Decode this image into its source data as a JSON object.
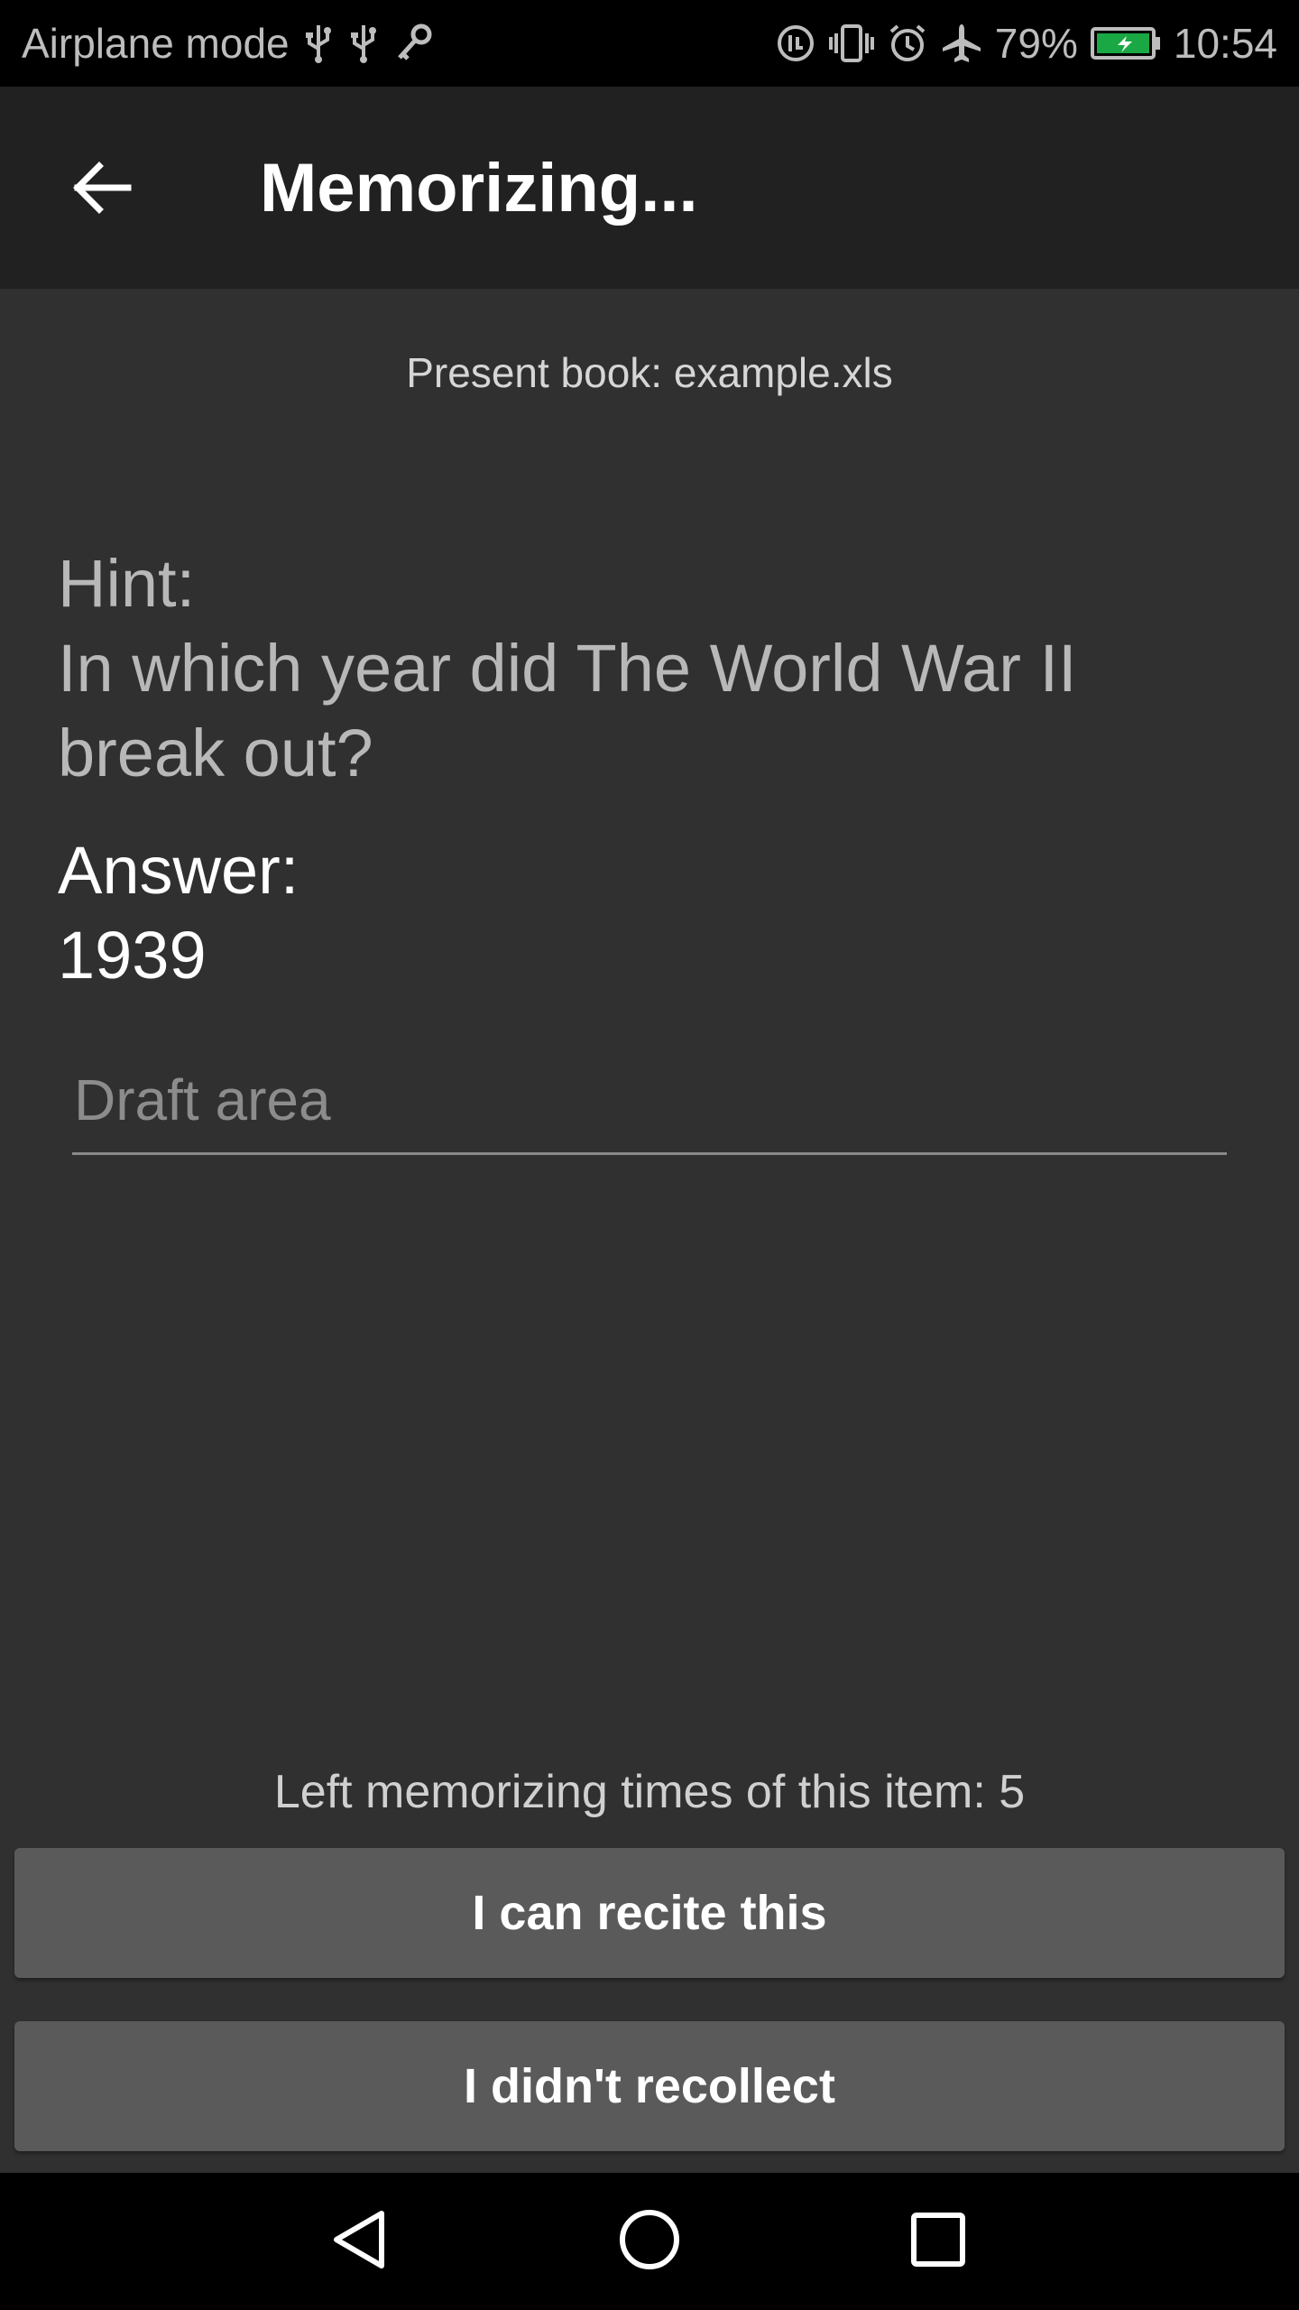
{
  "status_bar": {
    "airplane_label": "Airplane mode",
    "battery_percent": "79%",
    "time": "10:54",
    "icons_left": [
      "usb-icon",
      "usb-icon",
      "key-icon"
    ],
    "icons_right": [
      "data-saver-icon",
      "vibrate-icon",
      "alarm-icon",
      "airplane-icon",
      "battery-charging-icon"
    ],
    "battery_color": "#19a843"
  },
  "app_bar": {
    "title": "Memorizing..."
  },
  "content": {
    "book_line": "Present book: example.xls",
    "hint_label": "Hint:",
    "hint_text": "In which year did The World War II break out?",
    "answer_label": "Answer:",
    "answer_text": "1939",
    "draft_placeholder": "Draft area",
    "draft_value": "",
    "times_left": "Left memorizing times of this item: 5"
  },
  "buttons": {
    "recite_label": "I can recite this",
    "forgot_label": "I didn't recollect"
  },
  "nav_bar": {
    "icons": [
      "back-triangle-icon",
      "home-circle-icon",
      "recents-square-icon"
    ]
  },
  "colors": {
    "background": "#303030",
    "app_bar": "#212121",
    "button": "#5a5a5a"
  }
}
